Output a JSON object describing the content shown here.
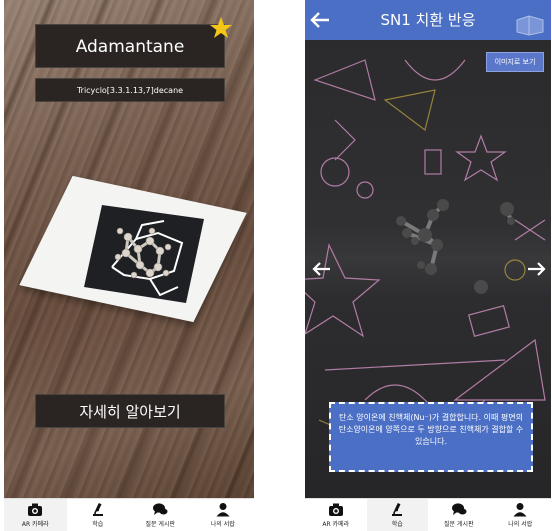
{
  "left_screen": {
    "molecule_name": "Adamantane",
    "iupac_name": "Tricyclo[3.3.1.13,7]decane",
    "learn_more_label": "자세히 알아보기",
    "star_color": "#f5c518"
  },
  "right_screen": {
    "header_title": "SN1 치환 반응",
    "image_button_label": "이미지로 보기",
    "description": "탄소 양이온에 친핵체(Nu⁻)가 결합합니다. 이때 평면의 탄소양이온에 양쪽으로 두 방향으로 친핵체가 결합할 수 있습니다.",
    "header_color": "#4b6fc4"
  },
  "tabs": [
    {
      "label": "AR 카메라",
      "icon": "camera-icon"
    },
    {
      "label": "학습",
      "icon": "microscope-icon"
    },
    {
      "label": "질문 게시판",
      "icon": "chat-icon"
    },
    {
      "label": "나의 서랍",
      "icon": "person-icon"
    }
  ],
  "left_active_tab": 0,
  "right_active_tab": 1
}
